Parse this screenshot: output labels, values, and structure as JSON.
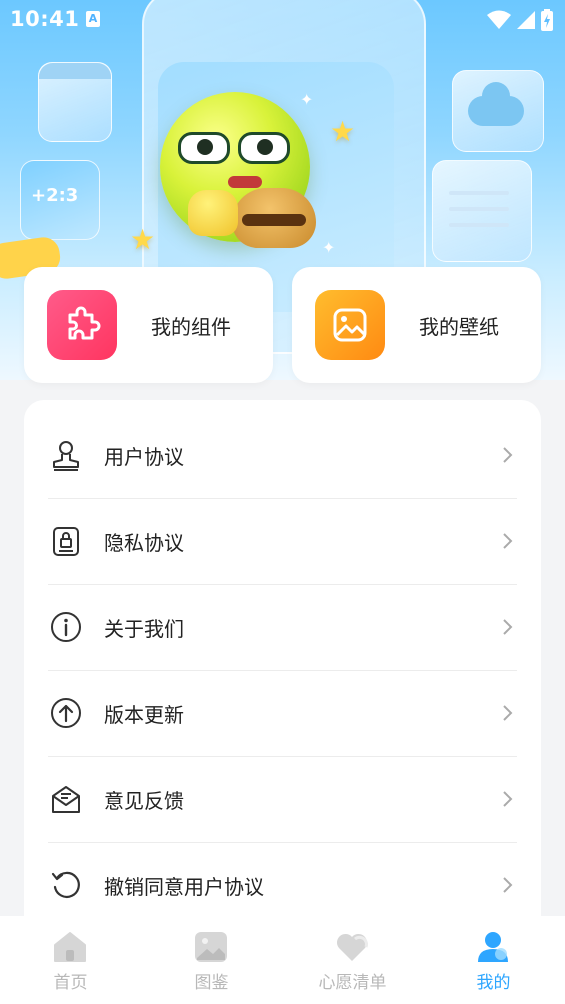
{
  "status_bar": {
    "time": "10:41"
  },
  "quick_cards": [
    {
      "label": "我的组件",
      "icon": "puzzle-icon"
    },
    {
      "label": "我的壁纸",
      "icon": "image-icon"
    }
  ],
  "menu": {
    "items": [
      {
        "label": "用户协议",
        "icon": "user-stamp-icon"
      },
      {
        "label": "隐私协议",
        "icon": "lock-document-icon"
      },
      {
        "label": "关于我们",
        "icon": "info-icon"
      },
      {
        "label": "版本更新",
        "icon": "upgrade-arrow-icon"
      },
      {
        "label": "意见反馈",
        "icon": "feedback-mail-icon"
      },
      {
        "label": "撤销同意用户协议",
        "icon": "revoke-icon"
      }
    ]
  },
  "tabbar": {
    "tabs": [
      {
        "label": "首页",
        "icon": "home-icon",
        "active": false
      },
      {
        "label": "图鉴",
        "icon": "gallery-icon",
        "active": false
      },
      {
        "label": "心愿清单",
        "icon": "heart-icon",
        "active": false
      },
      {
        "label": "我的",
        "icon": "profile-icon",
        "active": true
      }
    ]
  },
  "colors": {
    "accent": "#2ea6ff",
    "widget_card": "#ff4070",
    "wallpaper_card": "#ffa020",
    "inactive_tab": "#b8b8b8"
  }
}
